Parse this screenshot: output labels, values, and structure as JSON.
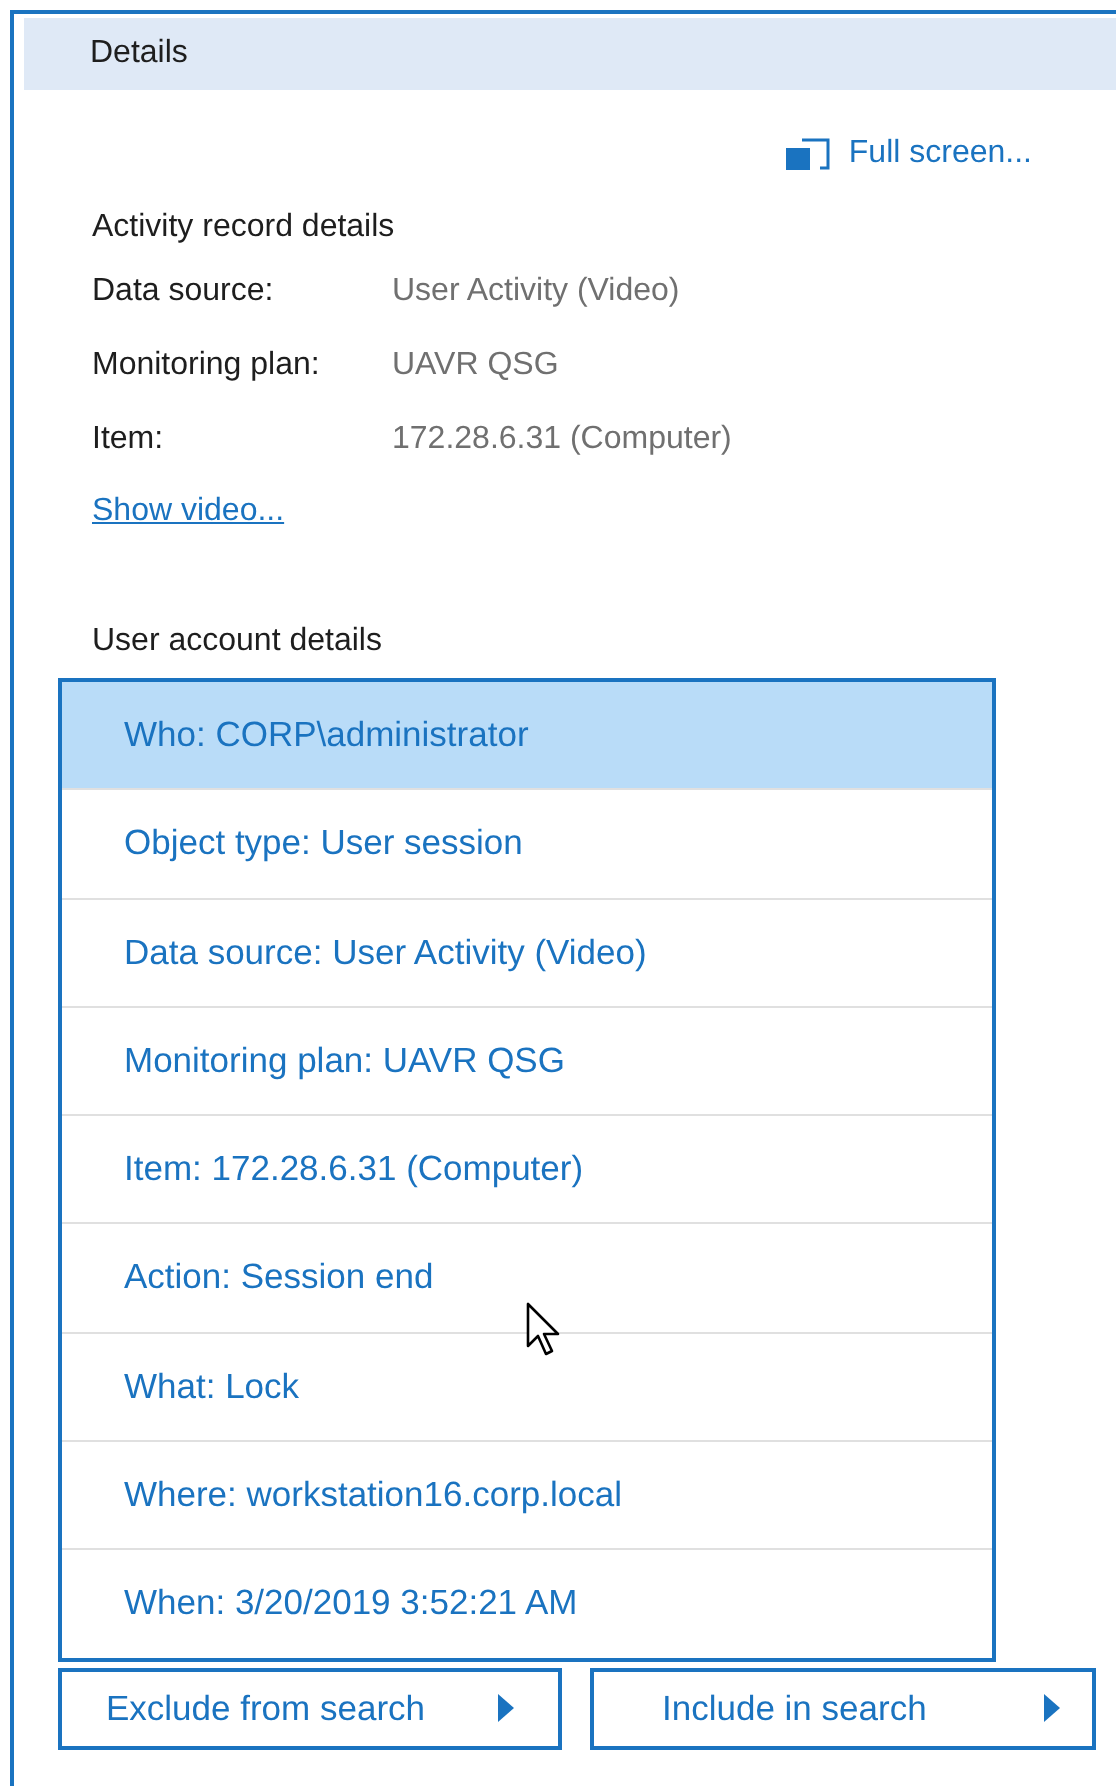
{
  "panel": {
    "title": "Details"
  },
  "full_screen_link": "Full screen...",
  "activity_section": {
    "heading": "Activity record details",
    "fields": [
      {
        "label": "Data source:",
        "value": "User Activity (Video)"
      },
      {
        "label": "Monitoring plan:",
        "value": "UAVR QSG"
      },
      {
        "label": "Item:",
        "value": "172.28.6.31 (Computer)"
      }
    ],
    "link": "Show video..."
  },
  "account_section": {
    "heading": "User account details",
    "items": [
      {
        "text": "Who: CORP\\administrator",
        "selected": true
      },
      {
        "text": "Object type: User session",
        "selected": false
      },
      {
        "text": "Data source: User Activity (Video)",
        "selected": false
      },
      {
        "text": "Monitoring plan: UAVR QSG",
        "selected": false
      },
      {
        "text": "Item: 172.28.6.31 (Computer)",
        "selected": false
      },
      {
        "text": "Action: Session end",
        "selected": false
      },
      {
        "text": "What: Lock",
        "selected": false
      },
      {
        "text": "Where: workstation16.corp.local",
        "selected": false
      },
      {
        "text": "When: 3/20/2019 3:52:21 AM",
        "selected": false
      }
    ]
  },
  "buttons": [
    "Exclude from search",
    "Include in search"
  ]
}
